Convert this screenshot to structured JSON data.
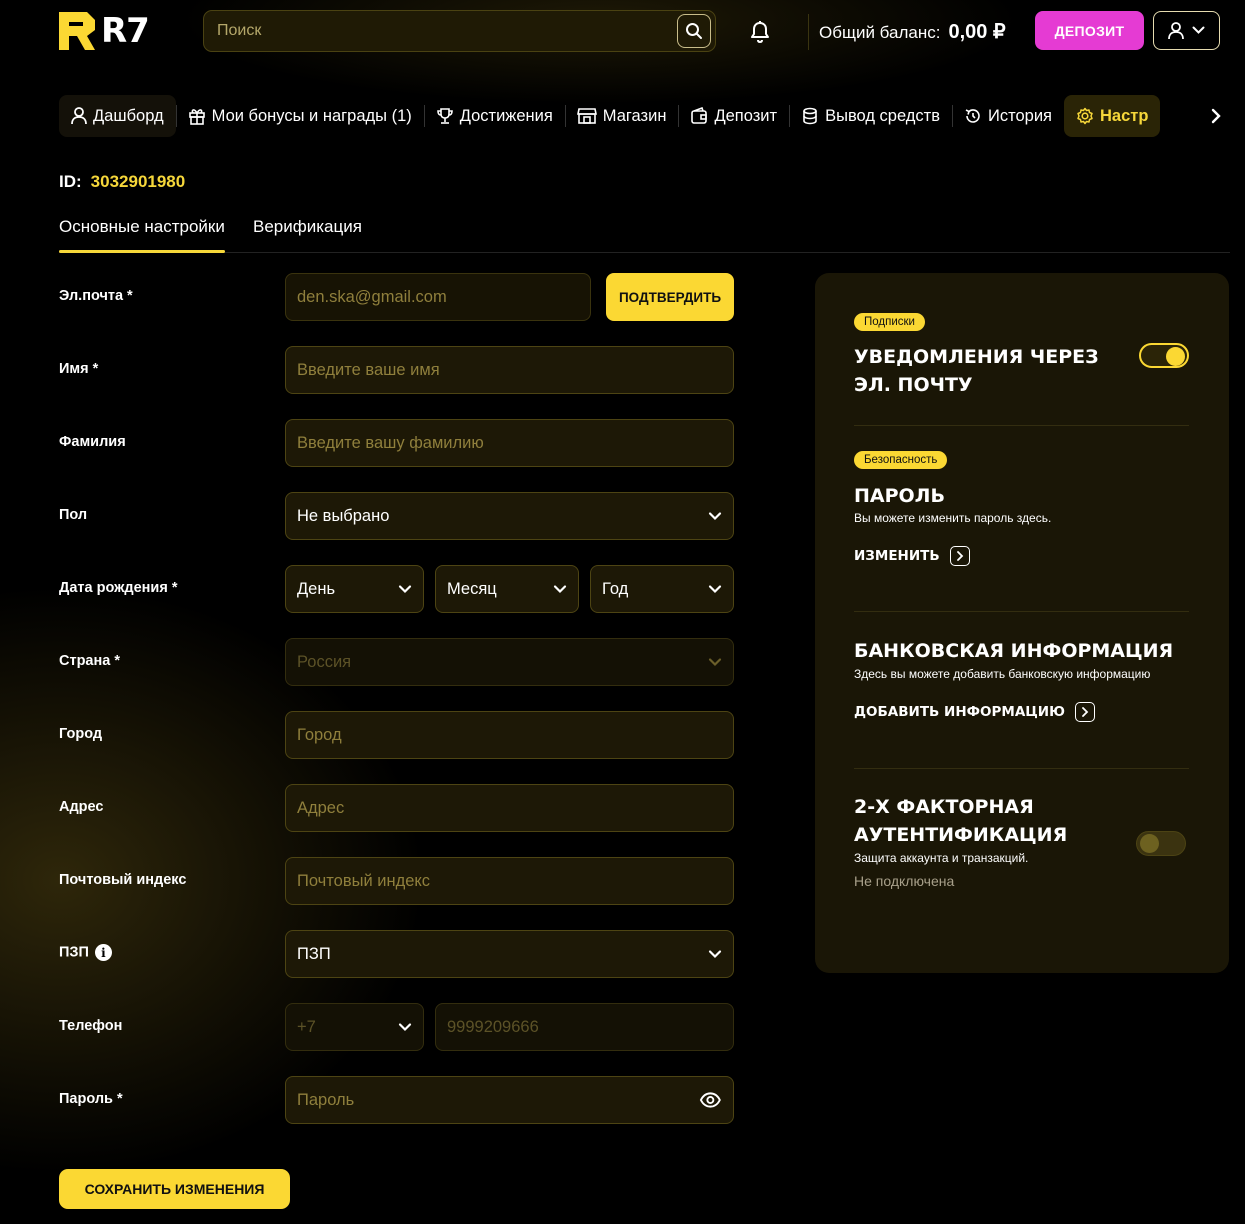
{
  "header": {
    "logo_text": "R7",
    "search_placeholder": "Поиск",
    "balance_label": "Общий баланс:",
    "balance_value": "0,00 ₽",
    "deposit_button": "ДЕПОЗИТ"
  },
  "nav": {
    "items": [
      {
        "label": "Дашборд",
        "icon": "user-icon"
      },
      {
        "label": "Мои бонусы и награды (1)",
        "icon": "gift-icon"
      },
      {
        "label": "Достижения",
        "icon": "trophy-icon"
      },
      {
        "label": "Магазин",
        "icon": "shop-icon"
      },
      {
        "label": "Депозит",
        "icon": "wallet-icon"
      },
      {
        "label": "Вывод средств",
        "icon": "coins-icon"
      },
      {
        "label": "История",
        "icon": "history-icon"
      },
      {
        "label": "Настр",
        "icon": "gear-icon"
      }
    ]
  },
  "account": {
    "id_label": "ID:",
    "id_value": "3032901980"
  },
  "tabs": {
    "main": "Основные настройки",
    "verification": "Верификация"
  },
  "form": {
    "email": {
      "label": "Эл.почта *",
      "placeholder": "den.ska@gmail.com",
      "confirm_button": "ПОДТВЕРДИТЬ"
    },
    "first_name": {
      "label": "Имя *",
      "placeholder": "Введите ваше имя"
    },
    "last_name": {
      "label": "Фамилия",
      "placeholder": "Введите вашу фамилию"
    },
    "gender": {
      "label": "Пол",
      "value": "Не выбрано"
    },
    "birth_date": {
      "label": "Дата рождения *",
      "day": "День",
      "month": "Месяц",
      "year": "Год"
    },
    "country": {
      "label": "Страна *",
      "value": "Россия"
    },
    "city": {
      "label": "Город",
      "placeholder": "Город"
    },
    "address": {
      "label": "Адрес",
      "placeholder": "Адрес"
    },
    "postal_code": {
      "label": "Почтовый индекс",
      "placeholder": "Почтовый индекс"
    },
    "pzp": {
      "label": "ПЗП",
      "value": "ПЗП"
    },
    "phone": {
      "label": "Телефон",
      "code": "+7",
      "placeholder": "9999209666"
    },
    "password": {
      "label": "Пароль *",
      "placeholder": "Пароль"
    },
    "save_button": "СОХРАНИТЬ ИЗМЕНЕНИЯ"
  },
  "panel": {
    "subscriptions": {
      "badge": "Подписки",
      "title_line1": "УВЕДОМЛЕНИЯ ЧЕРЕЗ",
      "title_line2": "ЭЛ. ПОЧТУ",
      "enabled": true
    },
    "password": {
      "badge": "Безопасность",
      "title": "ПАРОЛЬ",
      "subtitle": "Вы можете изменить пароль здесь.",
      "link": "ИЗМЕНИТЬ"
    },
    "bank": {
      "title": "БАНКОВСКАЯ ИНФОРМАЦИЯ",
      "subtitle": "Здесь вы можете добавить банковскую информацию",
      "link": "ДОБАВИТЬ ИНФОРМАЦИЮ"
    },
    "two_factor": {
      "title_line1": "2-Х ФАКТОРНАЯ",
      "title_line2": "АУТЕНТИФИКАЦИЯ",
      "subtitle": "Защита аккаунта и транзакций.",
      "status": "Не подключена",
      "enabled": false
    }
  },
  "colors": {
    "accent": "#fbd833",
    "deposit": "#e53bd3",
    "background": "#000000",
    "panel": "#1a1606"
  }
}
